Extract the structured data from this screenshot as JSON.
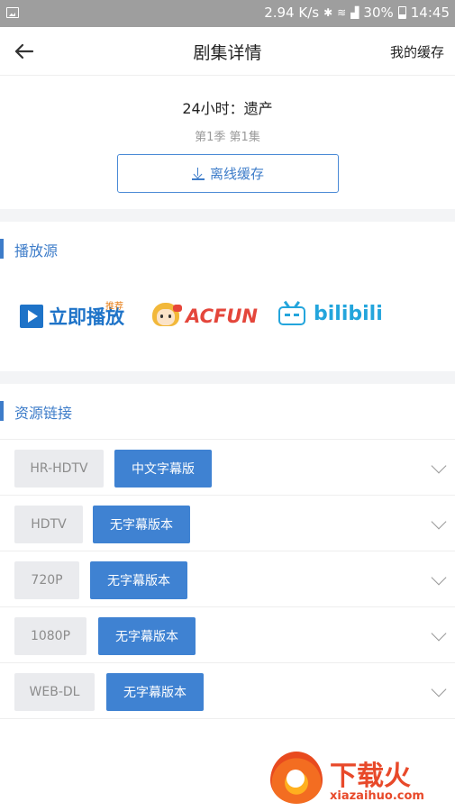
{
  "status_bar": {
    "speed": "2.94 K/s",
    "battery": "30%",
    "time": "14:45"
  },
  "header": {
    "title": "剧集详情",
    "right_link": "我的缓存",
    "back_icon": "arrow-left-icon"
  },
  "episode": {
    "title": "24小时：遗产",
    "subtitle": "第1季 第1集",
    "offline_button": "离线缓存"
  },
  "sources_section": {
    "title": "播放源",
    "sources": [
      {
        "name": "立即播放",
        "badge": "推荐",
        "color": "#1e73c8"
      },
      {
        "name": "AcFun",
        "display": "ACFUN",
        "color": "#e4463b"
      },
      {
        "name": "bilibili",
        "display": "bilibili",
        "color": "#23a5dc"
      }
    ]
  },
  "resources_section": {
    "title": "资源链接",
    "rows": [
      {
        "quality": "HR-HDTV",
        "tag": "中文字幕版"
      },
      {
        "quality": "HDTV",
        "tag": "无字幕版本"
      },
      {
        "quality": "720P",
        "tag": "无字幕版本"
      },
      {
        "quality": "1080P",
        "tag": "无字幕版本"
      },
      {
        "quality": "WEB-DL",
        "tag": "无字幕版本"
      }
    ]
  },
  "watermark": {
    "title": "下载火",
    "url": "xiazaihuo.com"
  },
  "colors": {
    "accent": "#3d7cc9",
    "tag_bg": "#3f82d2",
    "quality_bg": "#eaebee"
  }
}
